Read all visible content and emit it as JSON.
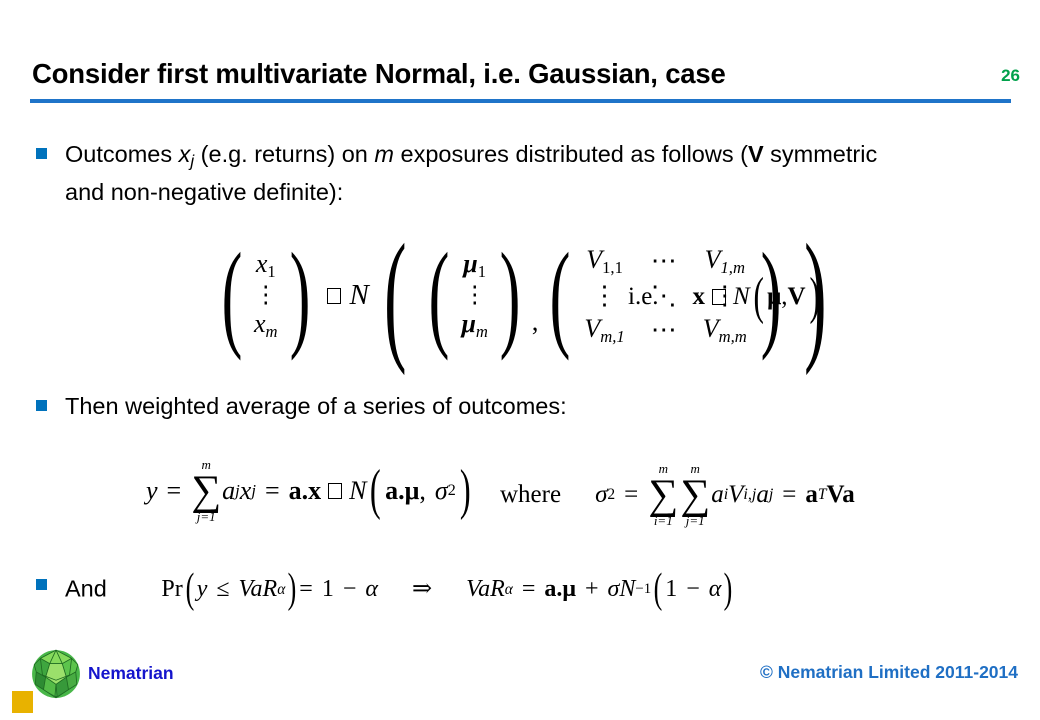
{
  "slide": {
    "title": "Consider first multivariate Normal, i.e. Gaussian, case",
    "page_number": "26",
    "rule_color": "#1F74C9",
    "page_number_color": "#00A14B",
    "bullet_color": "#0072BC"
  },
  "bullets": [
    {
      "id": "bullet-1",
      "text_parts": {
        "p1": "Outcomes ",
        "var_x": "x",
        "sub_j": "j",
        "p2": " (e.g. returns) on ",
        "var_m": "m",
        "p3": " exposures distributed as follows (",
        "bold_V": "V",
        "p4": " symmetric and non-negative definite):"
      }
    },
    {
      "id": "bullet-2",
      "text": "Then weighted average of a series of outcomes:"
    },
    {
      "id": "bullet-3",
      "text": "And"
    }
  ],
  "equation_1": {
    "lhs_vector": {
      "top": "x",
      "top_sub": "1",
      "dots": "⋮",
      "bottom": "x",
      "bottom_sub": "m"
    },
    "relation_glyph": "□",
    "distribution": "N",
    "mu_vector": {
      "top": "μ",
      "top_sub": "1",
      "dots": "⋮",
      "bottom": "μ",
      "bottom_sub": "m"
    },
    "separator": ",",
    "v_matrix": {
      "r1c1": "V",
      "r1c1_sub": "1,1",
      "r1c2": "⋯",
      "r1c3": "V",
      "r1c3_sub": "1,m",
      "r2c1": "⋮",
      "r2c2": "⋱",
      "r2c3": "⋮",
      "r3c1": "V",
      "r3c1_sub": "m,1",
      "r3c2": "⋯",
      "r3c3": "V",
      "r3c3_sub": "m,m"
    }
  },
  "ie_statement": {
    "label": "i.e.",
    "x_bold": "x",
    "relation_glyph": "□",
    "distribution": "N",
    "open_paren": "(",
    "mu_bold": "μ",
    "comma": ",",
    "v_bold": "V",
    "close_paren": ")"
  },
  "equation_2": {
    "y": "y",
    "eq1": "=",
    "sigma_glyph": "∑",
    "sum_upper": "m",
    "sum_lower": "j=1",
    "a": "a",
    "a_sub": "j",
    "x": "x",
    "x_sub": "j",
    "eq2": "=",
    "ax_bold": "a.x",
    "relation_glyph": "□",
    "distribution": "N",
    "open_paren": "(",
    "amu_bold": "a.μ",
    "comma": ",",
    "sigma_var": "σ",
    "sigma_sup": "2",
    "close_paren": ")"
  },
  "equation_2_where": {
    "where_label": "where",
    "sigma_var": "σ",
    "sigma_sup": "2",
    "eq1": "=",
    "sigma_glyph": "∑",
    "sum1_upper": "m",
    "sum1_lower": "i=1",
    "sum2_upper": "m",
    "sum2_lower": "j=1",
    "a1": "a",
    "a1_sub": "i",
    "V": "V",
    "V_sub": "i,j",
    "a2": "a",
    "a2_sub": "j",
    "eq2": "=",
    "a_bold": "a",
    "transpose_sup": "T",
    "Va_bold": "Va"
  },
  "equation_3": {
    "pr_label": "Pr",
    "open_paren": "(",
    "y": "y",
    "leq": "≤",
    "VaR": "VaR",
    "VaR_sub": "α",
    "close_paren": ")",
    "eq1": "=",
    "one": "1",
    "minus": "−",
    "alpha": "α",
    "implies": "⇒",
    "VaR2": "VaR",
    "VaR2_sub": "α",
    "eq2": "=",
    "amu_bold": "a.μ",
    "plus": "+",
    "sigma_var": "σ",
    "N": "N",
    "N_sup": "−1",
    "open_paren2": "(",
    "one2": "1",
    "minus2": "−",
    "alpha2": "α",
    "close_paren2": ")"
  },
  "footer": {
    "brand": "Nematrian",
    "copyright": "© Nematrian Limited 2011-2014",
    "brand_color": "#1414CC",
    "copyright_color": "#1F6FC4",
    "accent_color": "#E8B200",
    "logo_name": "nematrian-polyhedron-logo"
  }
}
